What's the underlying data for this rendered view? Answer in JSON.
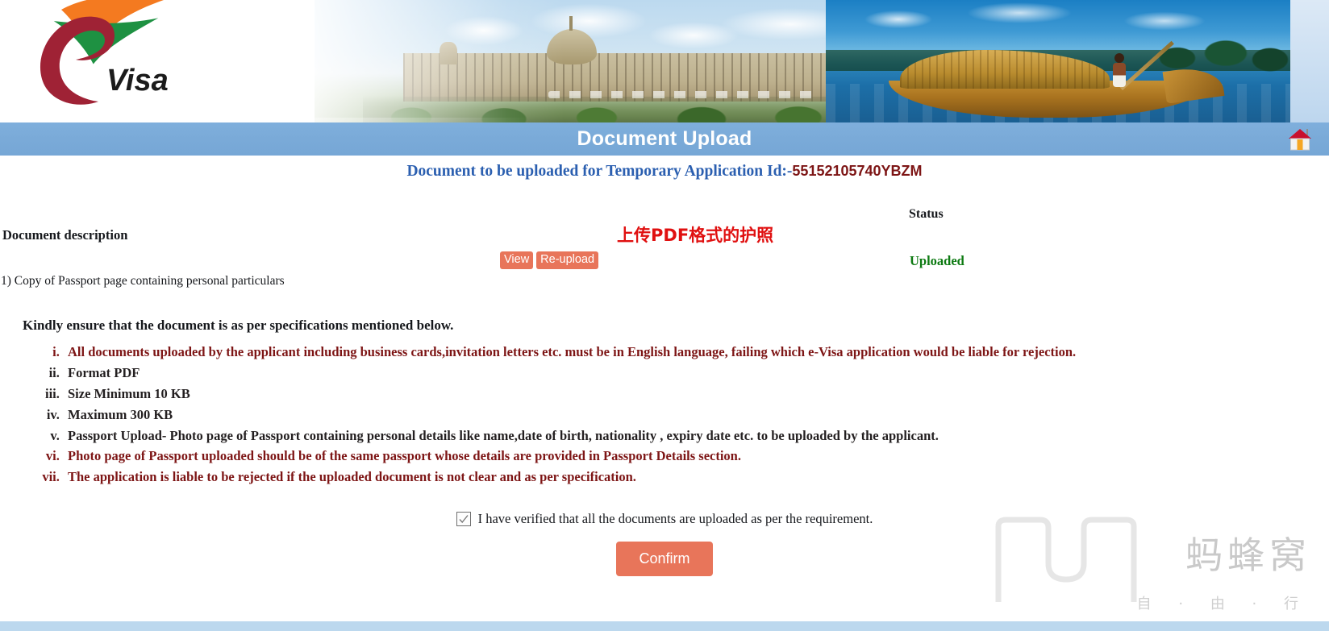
{
  "header": {
    "logo_text": "e-Visa",
    "logo_letter": "e",
    "logo_word": "Visa",
    "banner_left_icon": "evisa-logo",
    "banner_images": [
      "rashtrapati-bhavan-photo",
      "kerala-houseboat-photo"
    ]
  },
  "title_bar": {
    "title": "Document Upload",
    "home_icon": "home-icon"
  },
  "page": {
    "app_id_prefix": "Document to be uploaded for Temporary Application Id:-",
    "app_id_value": "55152105740YBZM",
    "annotation_cn": "上传PDF格式的护照"
  },
  "table": {
    "description_header": "Document description",
    "status_header": "Status",
    "row_label": "1) Copy of Passport page containing personal particulars",
    "view_label": "View",
    "reupload_label": "Re-upload",
    "status_value": "Uploaded",
    "status_color": "#0d7a12"
  },
  "spec": {
    "title": "Kindly ensure that the document is as per specifications mentioned below.",
    "items": [
      {
        "text": "All documents uploaded by the applicant including business cards,invitation letters etc. must be in English language, failing which e-Visa application would be liable for rejection.",
        "color": "red"
      },
      {
        "text": "Format PDF",
        "color": "dark"
      },
      {
        "text": "Size Minimum 10 KB",
        "color": "dark"
      },
      {
        "text": "Maximum 300 KB",
        "color": "dark"
      },
      {
        "text": "Passport Upload- Photo page of Passport containing personal details like name,date of birth, nationality , expiry date etc. to be uploaded by the applicant.",
        "color": "dark"
      },
      {
        "text": "Photo page of Passport uploaded should be of the same passport whose details are provided in Passport Details section.",
        "color": "red"
      },
      {
        "text": "The application is liable to be rejected if the uploaded document is not clear and as per specification.",
        "color": "red"
      }
    ]
  },
  "footer": {
    "verify_label": "I have verified that all the documents are uploaded as per the requirement.",
    "verify_checked": true,
    "confirm_label": "Confirm"
  },
  "watermark": {
    "brand_cn": "蚂蜂窝",
    "tagline_cn": "自 · 由 · 行"
  },
  "colors": {
    "title_bar": "#7aaad8",
    "accent_button": "#e8755a",
    "app_id_label": "#2b5fb0",
    "app_id_value": "#7d1515",
    "spec_red": "#7d1515",
    "status_green": "#0d7a12",
    "annotation_red": "#e01010"
  }
}
